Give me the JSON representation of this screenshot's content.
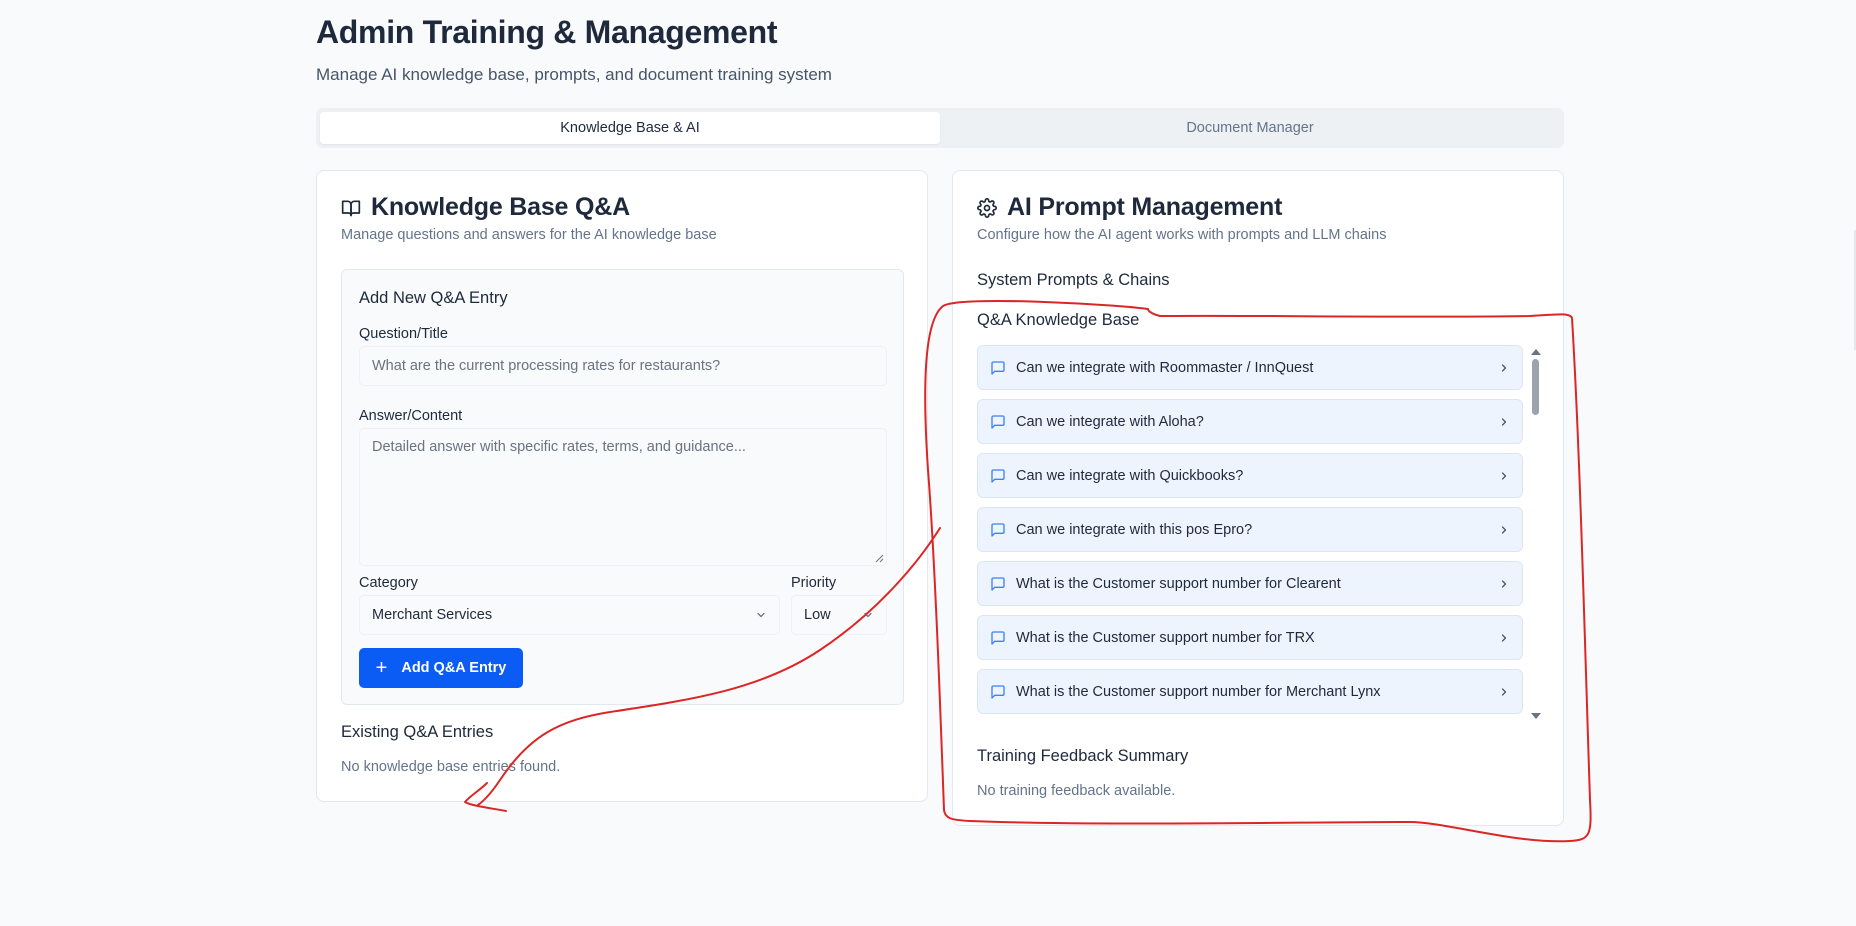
{
  "header": {
    "title": "Admin Training & Management",
    "subtitle": "Manage AI knowledge base, prompts, and document training system"
  },
  "tabs": [
    {
      "label": "Knowledge Base & AI",
      "active": true
    },
    {
      "label": "Document Manager",
      "active": false
    }
  ],
  "knowledge_base": {
    "icon": "book-open-icon",
    "title": "Knowledge Base Q&A",
    "description": "Manage questions and answers for the AI knowledge base",
    "form": {
      "heading": "Add New Q&A Entry",
      "question_label": "Question/Title",
      "question_placeholder": "What are the current processing rates for restaurants?",
      "answer_label": "Answer/Content",
      "answer_placeholder": "Detailed answer with specific rates, terms, and guidance...",
      "category_label": "Category",
      "category_value": "Merchant Services",
      "priority_label": "Priority",
      "priority_value": "Low",
      "add_button_label": "Add Q&A Entry"
    },
    "existing_title": "Existing Q&A Entries",
    "empty_text": "No knowledge base entries found."
  },
  "ai_prompt": {
    "icon": "gear-icon",
    "title": "AI Prompt Management",
    "description": "Configure how the AI agent works with prompts and LLM chains",
    "system_prompts_title": "System Prompts & Chains",
    "qa_kb_title": "Q&A Knowledge Base",
    "qa_items": [
      "Can we integrate with Roommaster / InnQuest",
      "Can we integrate with Aloha?",
      "Can we integrate with Quickbooks?",
      "Can we integrate with this pos Epro?",
      "What is the Customer support number for Clearent",
      "What is the Customer support number for TRX",
      "What is the Customer support number for Merchant Lynx"
    ],
    "feedback_title": "Training Feedback Summary",
    "feedback_empty": "No training feedback available."
  },
  "colors": {
    "accent": "#0b5cf5",
    "annotation": "#dc2626",
    "item_bg": "#eef4fd"
  }
}
